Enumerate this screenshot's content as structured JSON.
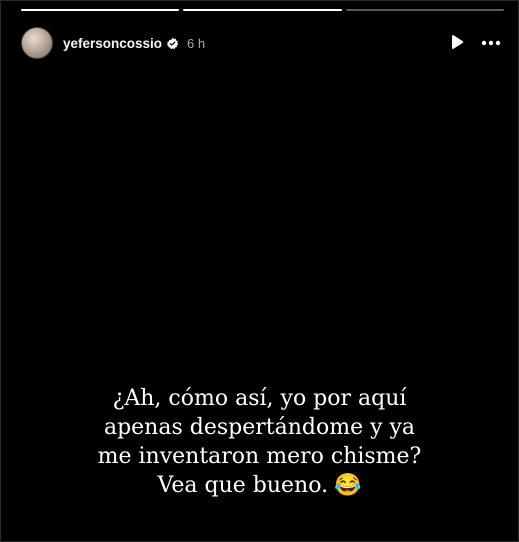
{
  "story": {
    "username": "yefersoncossio",
    "time": "6 h",
    "progress": [
      1,
      1,
      0
    ],
    "caption_lines": [
      "¿Ah, cómo así, yo por aquí",
      "apenas despertándome y ya",
      "me inventaron mero chisme?",
      "Vea que bueno."
    ],
    "emoji": "😂"
  },
  "icons": {
    "play": "play-icon",
    "more": "more-horizontal-icon",
    "verified": "verified-badge-icon"
  },
  "colors": {
    "background": "#000000",
    "text": "#ffffff",
    "secondary_text": "#a8a8a8",
    "verified_badge": "#ffffff"
  }
}
